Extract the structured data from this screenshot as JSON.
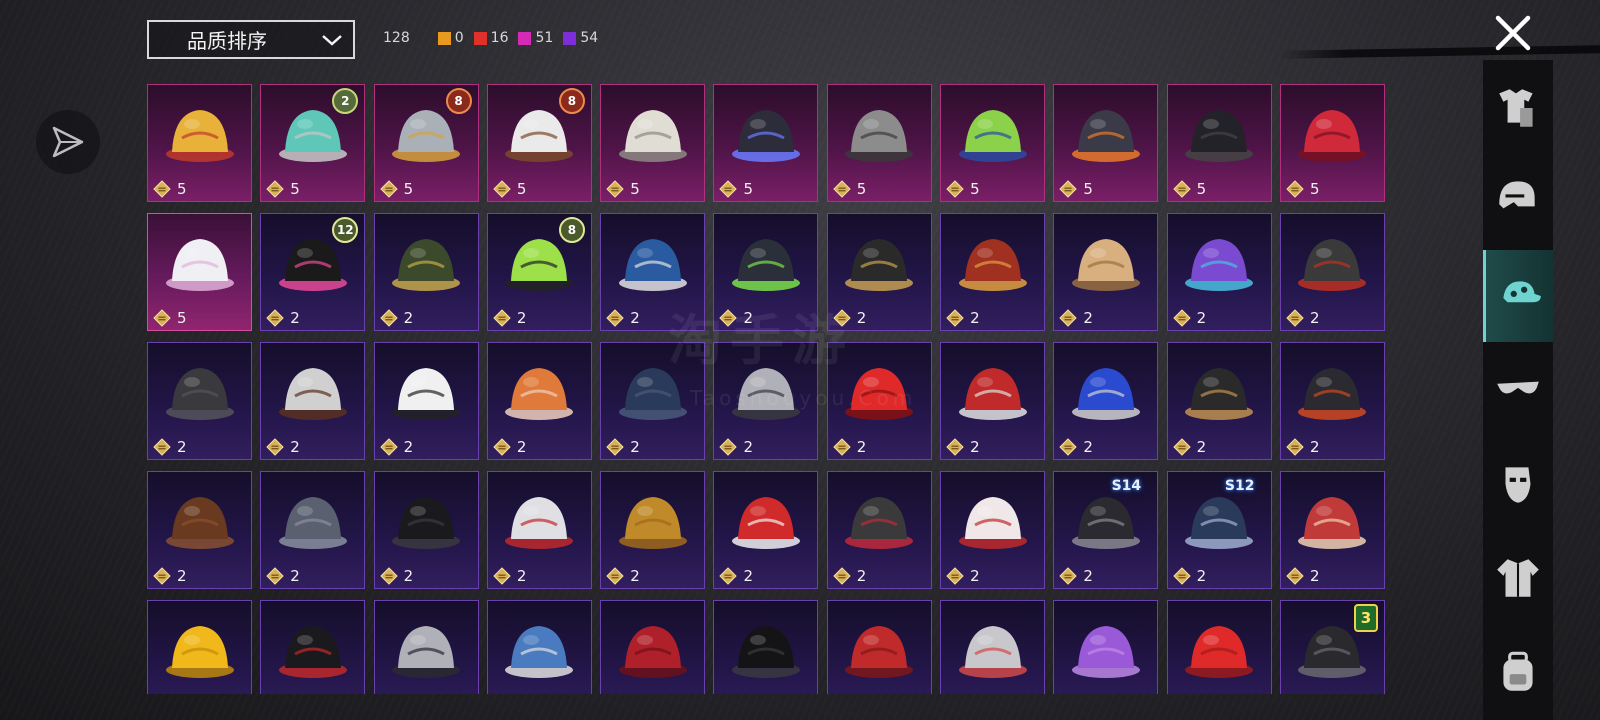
{
  "sort": {
    "label": "品质排序"
  },
  "counts": {
    "total": "128",
    "items": [
      {
        "color": "#e89a1e",
        "value": "0"
      },
      {
        "color": "#e0302a",
        "value": "16"
      },
      {
        "color": "#d42ab8",
        "value": "51"
      },
      {
        "color": "#7d2ed8",
        "value": "54"
      }
    ]
  },
  "watermark": {
    "main": "淘手游",
    "sub": "Taoshouyou.Com"
  },
  "rail": {
    "items": [
      {
        "icon": "outfit-icon",
        "active": false
      },
      {
        "icon": "helmet-icon",
        "active": false
      },
      {
        "icon": "cap-icon",
        "active": true
      },
      {
        "icon": "glasses-icon",
        "active": false
      },
      {
        "icon": "mask-icon",
        "active": false
      },
      {
        "icon": "jacket-icon",
        "active": false
      },
      {
        "icon": "backpack-icon",
        "active": false
      }
    ]
  },
  "items": [
    {
      "name": "jester-crown-mask",
      "cost": "5",
      "quality": "pink"
    },
    {
      "name": "teal-knight-helm",
      "cost": "5",
      "quality": "pink",
      "badge": "2",
      "badge_type": "green"
    },
    {
      "name": "mech-top-hat",
      "cost": "5",
      "quality": "pink",
      "badge": "8",
      "badge_type": "red"
    },
    {
      "name": "white-lantern-hat",
      "cost": "5",
      "quality": "pink",
      "badge": "8",
      "badge_type": "red"
    },
    {
      "name": "lion-dreads-head",
      "cost": "5",
      "quality": "pink"
    },
    {
      "name": "dark-visor-helmet",
      "cost": "5",
      "quality": "pink"
    },
    {
      "name": "wolf-head",
      "cost": "5",
      "quality": "pink"
    },
    {
      "name": "frog-cop-head",
      "cost": "5",
      "quality": "pink"
    },
    {
      "name": "gas-mask-hood",
      "cost": "5",
      "quality": "pink"
    },
    {
      "name": "black-horns-small",
      "cost": "5",
      "quality": "pink"
    },
    {
      "name": "red-devil-horns",
      "cost": "5",
      "quality": "pink"
    },
    {
      "name": "white-sun-hat",
      "cost": "5",
      "quality": "pink-light"
    },
    {
      "name": "bunny-ear-helmet",
      "cost": "2",
      "quality": "purple",
      "badge": "12",
      "badge_type": "olive"
    },
    {
      "name": "officer-caps",
      "cost": "2",
      "quality": "purple"
    },
    {
      "name": "green-skull-hair",
      "cost": "2",
      "quality": "purple",
      "badge": "8",
      "badge_type": "olive"
    },
    {
      "name": "blue-baseball-cap",
      "cost": "2",
      "quality": "purple"
    },
    {
      "name": "green-visor-helmet",
      "cost": "2",
      "quality": "purple"
    },
    {
      "name": "gold-visor-helmet",
      "cost": "2",
      "quality": "purple"
    },
    {
      "name": "red-hair-goggles",
      "cost": "2",
      "quality": "purple"
    },
    {
      "name": "bunny-bucket-hat",
      "cost": "2",
      "quality": "purple"
    },
    {
      "name": "galaxy-cap",
      "cost": "2",
      "quality": "purple"
    },
    {
      "name": "red-hair-helmet",
      "cost": "2",
      "quality": "purple"
    },
    {
      "name": "gray-flat-cap",
      "cost": "2",
      "quality": "purple"
    },
    {
      "name": "horned-hair-band",
      "cost": "2",
      "quality": "purple"
    },
    {
      "name": "white-wide-brim-hat",
      "cost": "2",
      "quality": "purple"
    },
    {
      "name": "fox-ears",
      "cost": "2",
      "quality": "purple"
    },
    {
      "name": "blue-beanie",
      "cost": "2",
      "quality": "purple"
    },
    {
      "name": "witch-hat",
      "cost": "2",
      "quality": "purple"
    },
    {
      "name": "red-feather-crest",
      "cost": "2",
      "quality": "purple"
    },
    {
      "name": "red-football-helmet",
      "cost": "2",
      "quality": "purple"
    },
    {
      "name": "blue-cricket-helmet",
      "cost": "2",
      "quality": "purple"
    },
    {
      "name": "steampunk-hat",
      "cost": "2",
      "quality": "purple"
    },
    {
      "name": "red-braid-mask",
      "cost": "2",
      "quality": "purple"
    },
    {
      "name": "brown-ponytail",
      "cost": "2",
      "quality": "purple"
    },
    {
      "name": "gray-cap",
      "cost": "2",
      "quality": "purple"
    },
    {
      "name": "black-gas-mask",
      "cost": "2",
      "quality": "purple"
    },
    {
      "name": "ski-goggle-beanie",
      "cost": "2",
      "quality": "purple"
    },
    {
      "name": "mustard-beanie",
      "cost": "2",
      "quality": "purple"
    },
    {
      "name": "red-bandana",
      "cost": "2",
      "quality": "purple"
    },
    {
      "name": "wrapped-bun",
      "cost": "2",
      "quality": "purple"
    },
    {
      "name": "kabuki-mask",
      "cost": "2",
      "quality": "purple"
    },
    {
      "name": "gladiator-helm",
      "cost": "2",
      "quality": "purple",
      "badge": "S14",
      "badge_type": "season"
    },
    {
      "name": "blue-knight-helm",
      "cost": "2",
      "quality": "purple",
      "badge": "S12",
      "badge_type": "season"
    },
    {
      "name": "red-curly-wig",
      "cost": "2",
      "quality": "purple"
    },
    {
      "name": "yellow-bucket-hat",
      "cost": "",
      "quality": "purple"
    },
    {
      "name": "black-top-hat",
      "cost": "",
      "quality": "purple"
    },
    {
      "name": "silver-mask",
      "cost": "",
      "quality": "purple"
    },
    {
      "name": "shark-hood",
      "cost": "",
      "quality": "purple"
    },
    {
      "name": "red-beret",
      "cost": "",
      "quality": "purple"
    },
    {
      "name": "black-fedora",
      "cost": "",
      "quality": "purple"
    },
    {
      "name": "red-fedora",
      "cost": "",
      "quality": "purple"
    },
    {
      "name": "white-shark-hood",
      "cost": "",
      "quality": "purple"
    },
    {
      "name": "flower-crown",
      "cost": "",
      "quality": "purple"
    },
    {
      "name": "red-bucket-hat",
      "cost": "",
      "quality": "purple"
    },
    {
      "name": "gray-fedora",
      "cost": "",
      "quality": "purple",
      "badge": "3",
      "badge_type": "shield"
    }
  ]
}
